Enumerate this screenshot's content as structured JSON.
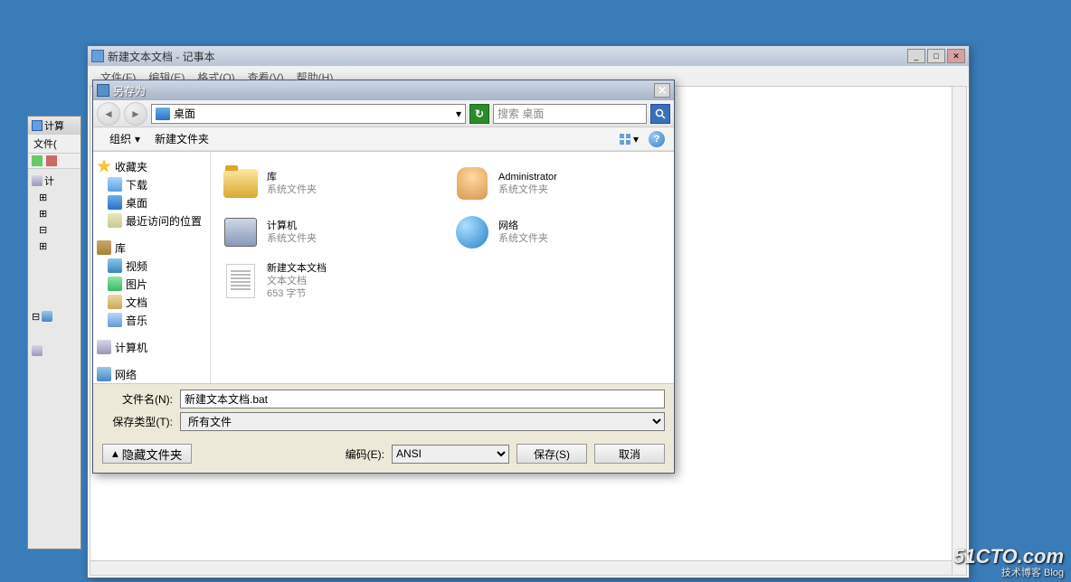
{
  "bgWindow": {
    "title": "计算",
    "menu": [
      "文件("
    ],
    "tree": [
      "计",
      "",
      "",
      "",
      "",
      ""
    ]
  },
  "notepad": {
    "title": "新建文本文档 - 记事本",
    "menu": [
      "文件(F)",
      "编辑(E)",
      "格式(O)",
      "查看(V)",
      "帮助(H)"
    ]
  },
  "dialog": {
    "title": "另存为",
    "address": "桌面",
    "searchPlaceholder": "搜索 桌面",
    "toolbar": {
      "organize": "组织",
      "newFolder": "新建文件夹"
    },
    "sidebar": {
      "fav": {
        "label": "收藏夹",
        "items": [
          "下载",
          "桌面",
          "最近访问的位置"
        ]
      },
      "lib": {
        "label": "库",
        "items": [
          "视频",
          "图片",
          "文档",
          "音乐"
        ]
      },
      "comp": "计算机",
      "net": "网络"
    },
    "files": [
      {
        "name": "库",
        "line2": "系统文件夹",
        "icon": "lib"
      },
      {
        "name": "Administrator",
        "line2": "系统文件夹",
        "icon": "user"
      },
      {
        "name": "计算机",
        "line2": "系统文件夹",
        "icon": "comp"
      },
      {
        "name": "网络",
        "line2": "系统文件夹",
        "icon": "net"
      },
      {
        "name": "新建文本文档",
        "line2": "文本文档",
        "line3": "653 字节",
        "icon": "txt"
      }
    ],
    "fields": {
      "fileNameLabel": "文件名(N):",
      "fileNameValue": "新建文本文档.bat",
      "saveTypeLabel": "保存类型(T):",
      "saveTypeValue": "所有文件"
    },
    "footer": {
      "hideFolders": "隐藏文件夹",
      "encodingLabel": "编码(E):",
      "encodingValue": "ANSI",
      "save": "保存(S)",
      "cancel": "取消"
    }
  },
  "watermark": {
    "l1": "51CTO.com",
    "l2": "技术博客    Blog"
  }
}
